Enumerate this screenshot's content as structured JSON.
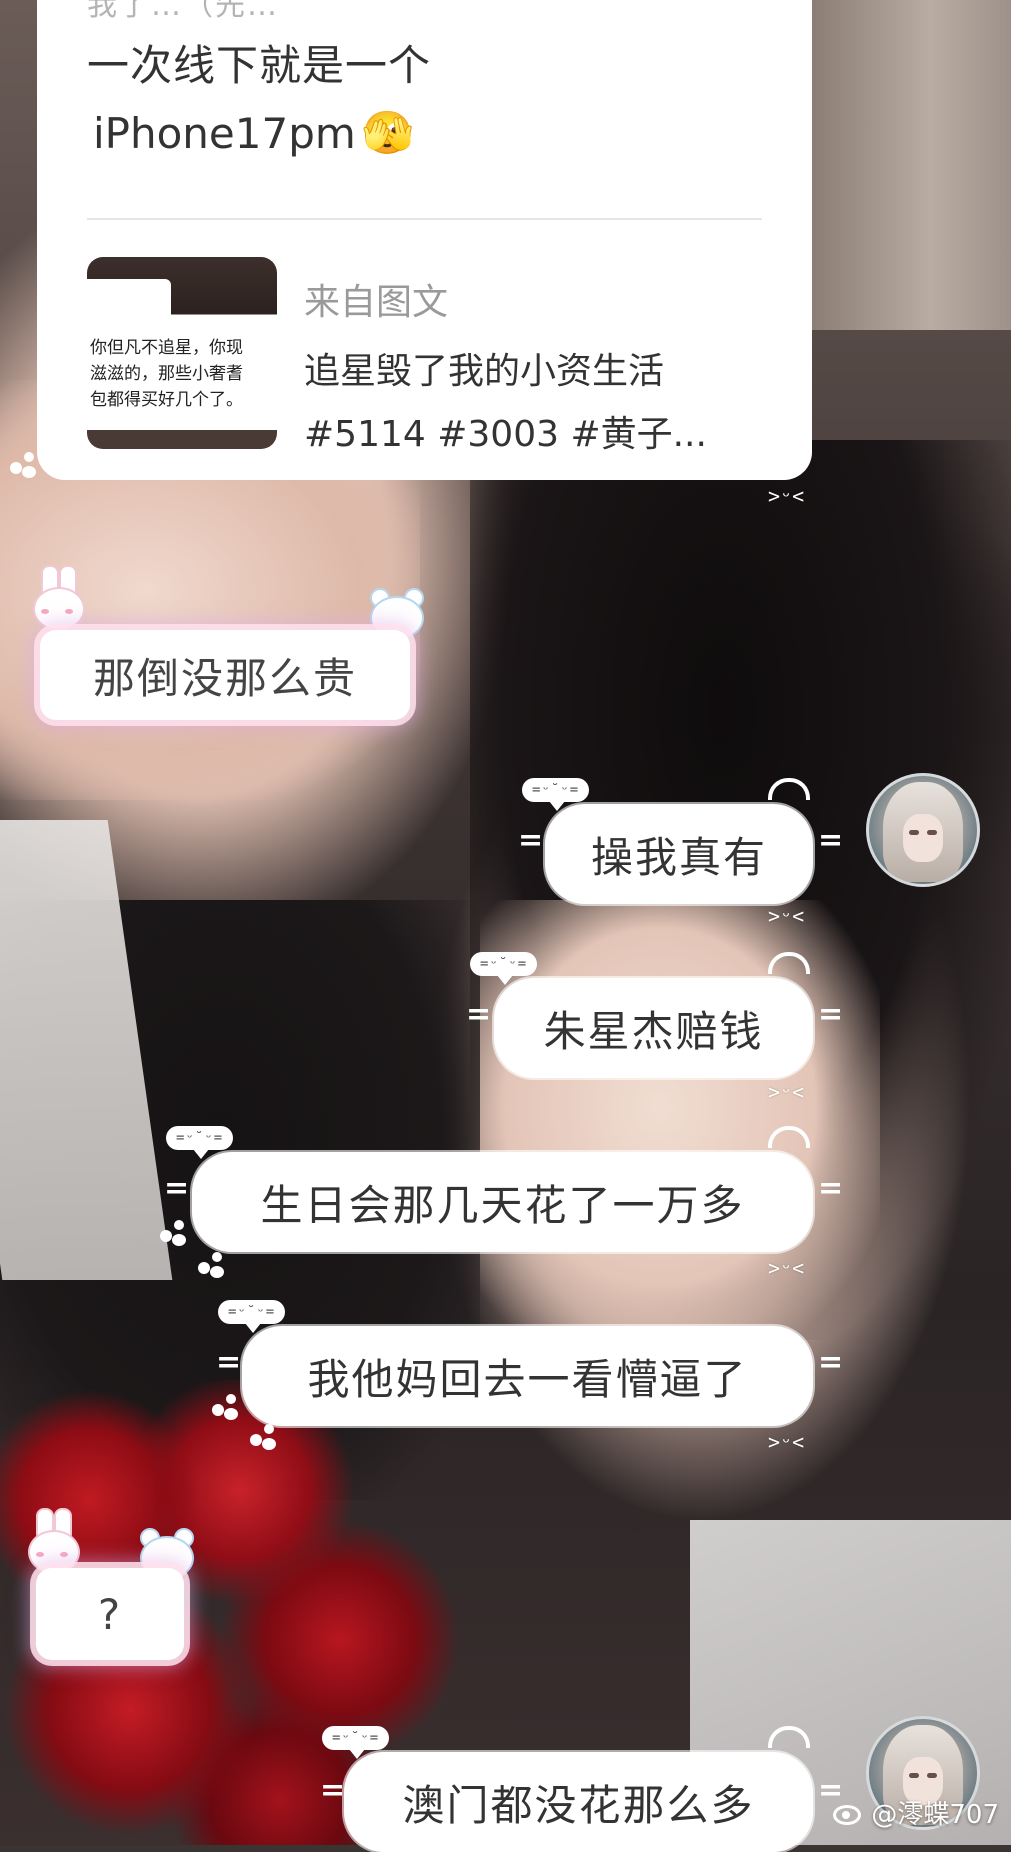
{
  "card": {
    "top_cutoff_text": "我了…（先…",
    "line1": "一次线下就是一个",
    "line2": "iPhone17pm",
    "line2_emoji": "🫣",
    "source_label": "来自图文",
    "source_line1": "追星毁了我的小资生活",
    "source_line2": "#5114 #3003 #黄子...",
    "thumb_text": "你但凡不追星，你现\n滋滋的，那些小奢耆\n包都得买好几个了。"
  },
  "messages": [
    {
      "side": "left",
      "text": "那倒没那么贵"
    },
    {
      "side": "right",
      "text": "操我真有",
      "face_tag": "=ᵕ˘ᵕ="
    },
    {
      "side": "right",
      "text": "朱星杰赔钱",
      "face_tag": "=ᵕ˘ᵕ="
    },
    {
      "side": "right",
      "text": "生日会那几天花了一万多",
      "face_tag": "=ᵕ˘ᵕ="
    },
    {
      "side": "right",
      "text": "我他妈回去一看懵逼了",
      "face_tag": "=ᵕ˘ᵕ="
    },
    {
      "side": "left",
      "text": "?"
    },
    {
      "side": "right",
      "text": "澳门都没花那么多",
      "face_tag": "=ᵕ˘ᵕ="
    }
  ],
  "deco_text": ">ᵕ<",
  "watermark": "@澪蝶707",
  "icons": {
    "avatar": "anime-avatar-icon",
    "weibo": "weibo-icon",
    "paw": "paw-print-icon",
    "bunny": "bunny-sticker-icon",
    "bear": "bear-sticker-icon"
  }
}
